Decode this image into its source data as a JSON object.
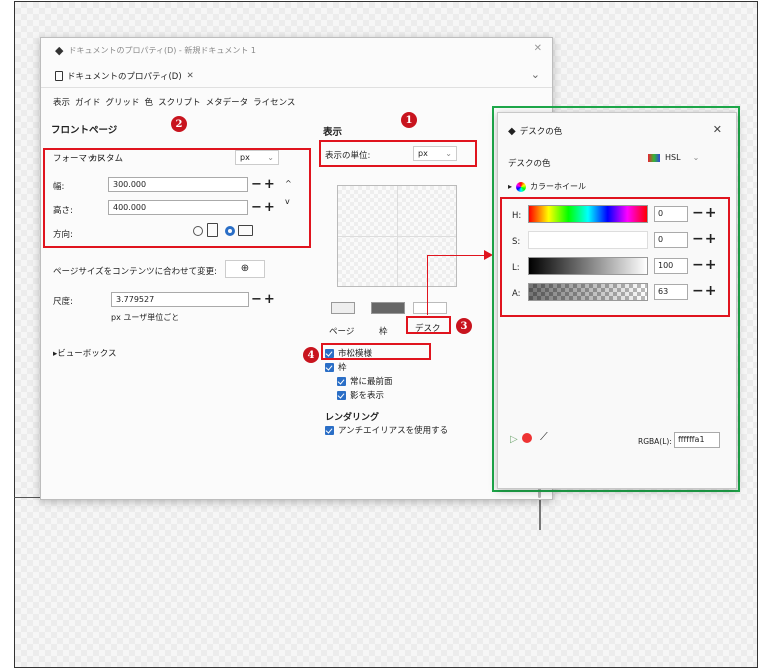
{
  "main_dialog": {
    "title": "ドキュメントのプロパティ(D) - 新規ドキュメント 1",
    "tab_label": "ドキュメントのプロパティ(D)",
    "menu": [
      "表示",
      "ガイド",
      "グリッド",
      "色",
      "スクリプト",
      "メタデータ",
      "ライセンス"
    ]
  },
  "front_page": {
    "title": "フロントページ",
    "format_label": "フォーマット",
    "format_value": "カスタム",
    "unit_value": "px",
    "width_label": "幅:",
    "width_value": "300.000",
    "height_label": "高さ:",
    "height_value": "400.000",
    "orientation_label": "方向:",
    "resize_label": "ページサイズをコンテンツに合わせて変更:",
    "scale_label": "尺度:",
    "scale_value": "3.779527",
    "scale_unit": "px ユーザ単位ごと",
    "viewbox_label": "ビューボックス"
  },
  "display": {
    "title": "表示",
    "unit_label": "表示の単位:",
    "unit_value": "px",
    "swatch_labels": [
      "ページ",
      "枠",
      "デスク"
    ],
    "checkboxes": [
      "市松模様",
      "枠",
      "常に最前面",
      "影を表示"
    ],
    "rendering_title": "レンダリング",
    "antialias_label": "アンチエイリアスを使用する"
  },
  "color_dialog": {
    "title": "デスクの色",
    "subtitle": "デスクの色",
    "mode": "HSL",
    "wheel_label": "カラーホイール",
    "channels": [
      {
        "label": "H:",
        "value": "0"
      },
      {
        "label": "S:",
        "value": "0"
      },
      {
        "label": "L:",
        "value": "100"
      },
      {
        "label": "A:",
        "value": "63"
      }
    ],
    "rgba_label": "RGBA(L):",
    "rgba_value": "ffffffa1"
  },
  "badges": [
    "1",
    "2",
    "3",
    "4"
  ],
  "colors": {
    "highlight_red": "#e0141e",
    "highlight_green": "#1ea84a",
    "accent_blue": "#2a6ec6",
    "badge_red": "#c8141e"
  }
}
